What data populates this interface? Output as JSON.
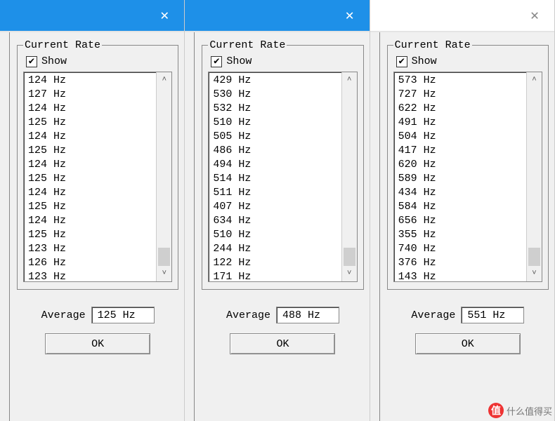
{
  "panels": [
    {
      "titlebar_style": "blue",
      "group_label": "Current Rate",
      "show_label": "Show",
      "show_checked": true,
      "rates": [
        "124 Hz",
        "127 Hz",
        "124 Hz",
        "125 Hz",
        "124 Hz",
        "125 Hz",
        "124 Hz",
        "125 Hz",
        "124 Hz",
        "125 Hz",
        "124 Hz",
        "125 Hz",
        "123 Hz",
        "126 Hz",
        "123 Hz"
      ],
      "average_label": "Average",
      "average_value": "125 Hz",
      "ok_label": "OK"
    },
    {
      "titlebar_style": "blue",
      "group_label": "Current Rate",
      "show_label": "Show",
      "show_checked": true,
      "rates": [
        "429 Hz",
        "530 Hz",
        "532 Hz",
        "510 Hz",
        "505 Hz",
        "486 Hz",
        "494 Hz",
        "514 Hz",
        "511 Hz",
        "407 Hz",
        "634 Hz",
        "510 Hz",
        "244 Hz",
        "122 Hz",
        "171 Hz"
      ],
      "average_label": "Average",
      "average_value": "488 Hz",
      "ok_label": "OK"
    },
    {
      "titlebar_style": "white",
      "group_label": "Current Rate",
      "show_label": "Show",
      "show_checked": true,
      "rates": [
        "573 Hz",
        "727 Hz",
        "622 Hz",
        "491 Hz",
        "504 Hz",
        "417 Hz",
        "620 Hz",
        "589 Hz",
        "434 Hz",
        "584 Hz",
        "656 Hz",
        "355 Hz",
        "740 Hz",
        "376 Hz",
        "143 Hz"
      ],
      "average_label": "Average",
      "average_value": "551 Hz",
      "ok_label": "OK"
    }
  ],
  "watermark": {
    "icon_text": "值",
    "text": "什么值得买"
  }
}
